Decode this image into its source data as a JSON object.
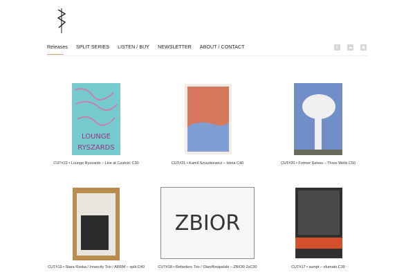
{
  "nav": {
    "items": [
      "Releases",
      "SPLIT SERIES",
      "LISTEN / BUY",
      "NEWSLETTER",
      "ABOUT / CONTACT"
    ],
    "active": "Releases"
  },
  "social": {
    "icons": [
      "facebook-icon",
      "soundcloud-icon",
      "rss-icon"
    ]
  },
  "releases": [
    {
      "caption": "CUT#22 • Lounge Ryszards – Live at Czułość C30",
      "cover_text": "LOUNGE RYSZARDS",
      "cover_color": "#76cbd0"
    },
    {
      "caption": "CUT#21 • Kamil Szuszkiewicz – Istnia C40",
      "cover_color": "#d5775a"
    },
    {
      "caption": "CUT#20 • Former Selves – Three Wells C50",
      "cover_color": "#7f9ac3"
    },
    {
      "caption": "CUT#19 • Stara Rzeka / Innercity Trio / ARRM – split C40",
      "cover_color": "#b88c4e"
    },
    {
      "caption": "CUT#18 • Refarders Trio / Olan/Kesipelski – ZBIOR 2xC30",
      "cover_text": "ZBIOR",
      "cover_color": "#f2f2f2"
    },
    {
      "caption": "CUT#17 • sumpt – sfumato C30",
      "cover_color": "#3a3a3a"
    }
  ]
}
